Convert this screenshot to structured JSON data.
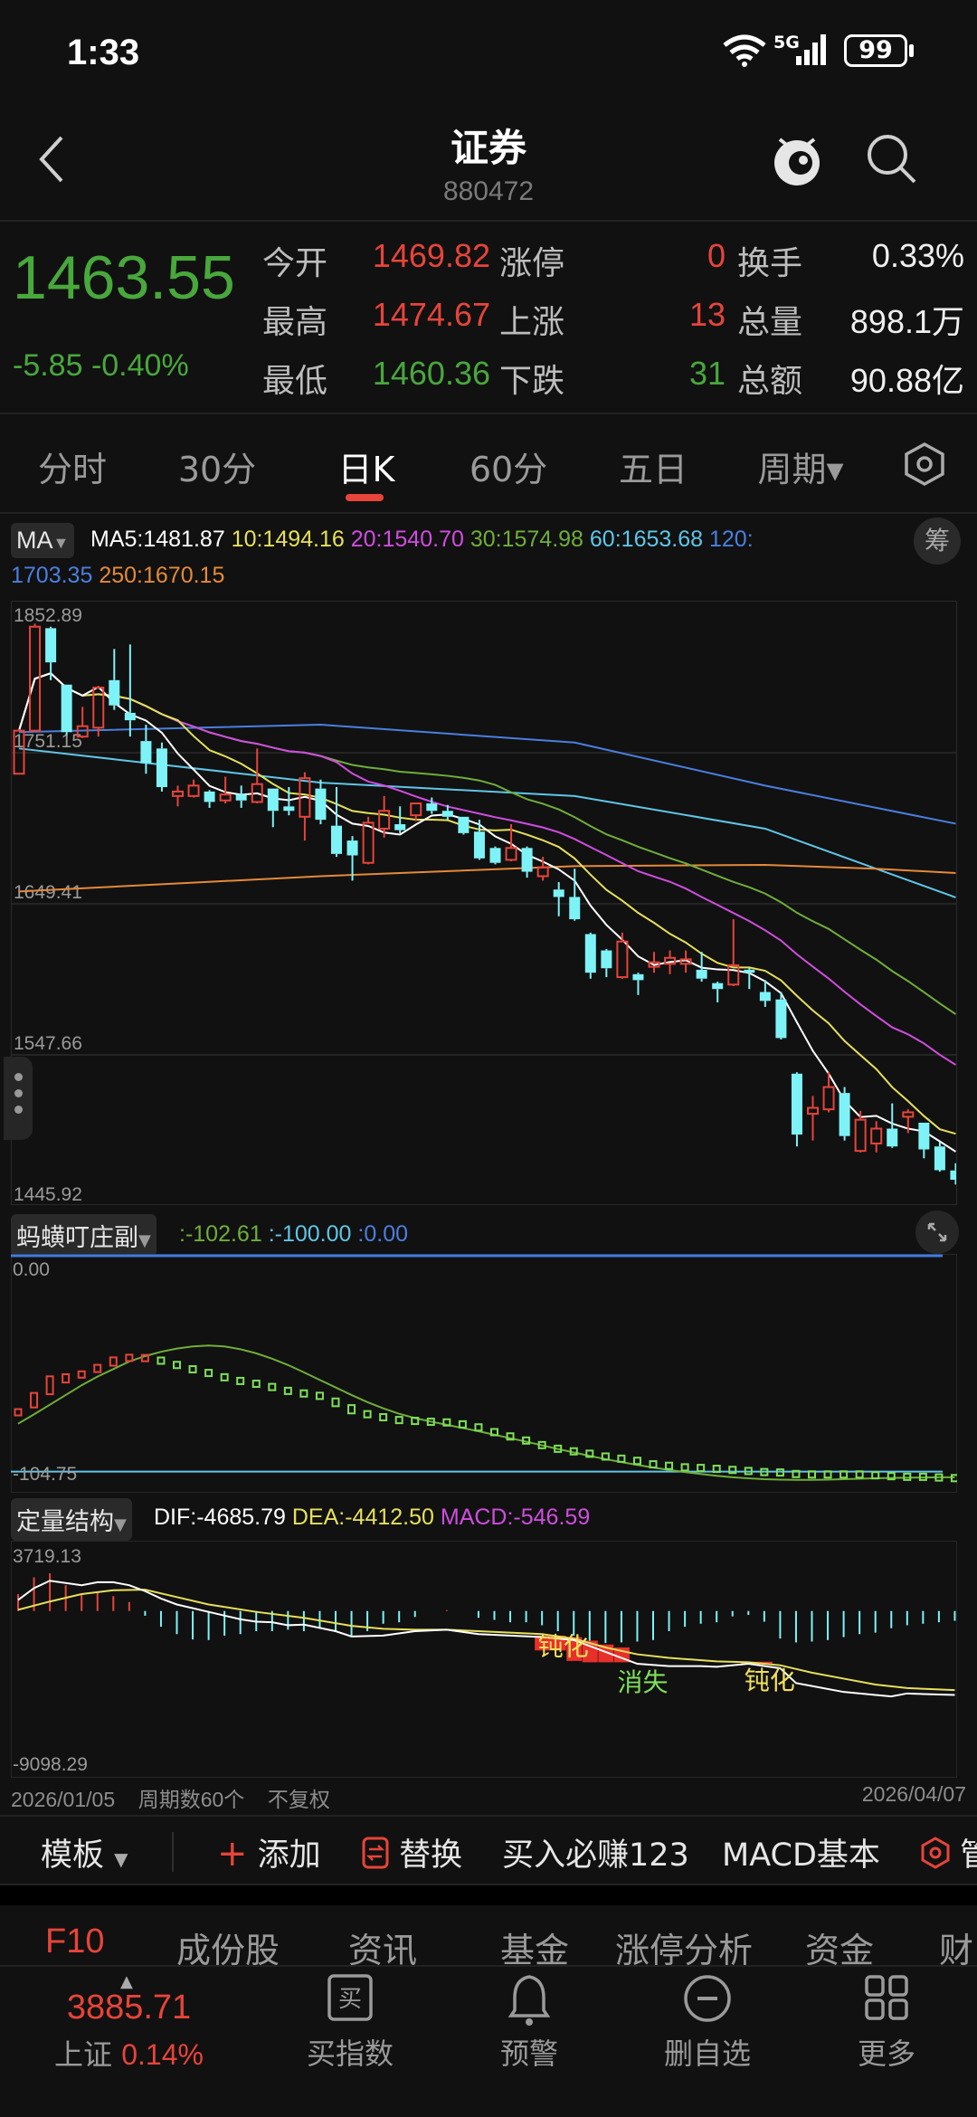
{
  "status_bar": {
    "time": "1:33",
    "network": "5G",
    "battery": "99"
  },
  "header": {
    "title": "证券",
    "code": "880472"
  },
  "quote": {
    "price": "1463.55",
    "change": "-5.85",
    "change_pct": "-0.40%",
    "rows": [
      {
        "label1": "今开",
        "value1": "1469.82",
        "color1": "#e8443a",
        "label2": "涨停",
        "count": "0",
        "count_color": "#e8443a",
        "label3": "换手",
        "value3": "0.33%"
      },
      {
        "label1": "最高",
        "value1": "1474.67",
        "color1": "#e8443a",
        "label2": "上涨",
        "count": "13",
        "count_color": "#e8443a",
        "label3": "总量",
        "value3": "898.1万"
      },
      {
        "label1": "最低",
        "value1": "1460.36",
        "color1": "#48a83c",
        "label2": "下跌",
        "count": "31",
        "count_color": "#48a83c",
        "label3": "总额",
        "value3": "90.88亿"
      }
    ]
  },
  "tabs": [
    {
      "label": "分时"
    },
    {
      "label": "30分"
    },
    {
      "label": "日K",
      "active": true
    },
    {
      "label": "60分"
    },
    {
      "label": "五日"
    },
    {
      "label": "周期▾"
    }
  ],
  "ma_legend": {
    "selector": "MA",
    "ma5": "MA5:1481.87",
    "ma10": "10:1494.16",
    "ma20": "20:1540.70",
    "ma30": "30:1574.98",
    "ma60": "60:1653.68",
    "ma120_label": "120:",
    "ma120_value": "1703.35",
    "ma250": "250:1670.15",
    "chip_button": "筹"
  },
  "sub1_legend": {
    "selector": "蚂蟥叮庄副",
    "v1": ":-102.61",
    "v2": ":-100.00",
    "v3": ":0.00"
  },
  "sub2_legend": {
    "selector": "定量结构",
    "dif": "DIF:-4685.79",
    "dea": "DEA:-4412.50",
    "macd": "MACD:-546.59"
  },
  "footer_info": {
    "start_date": "2026/01/05",
    "periods": "周期数60个",
    "adjust": "不复权",
    "end_date": "2026/04/07"
  },
  "toolbar": {
    "template": "模板",
    "add": "添加",
    "replace": "替换",
    "item1": "买入必赚123",
    "item2": "MACD基本",
    "manage": "管"
  },
  "f10_tabs": [
    "F10",
    "成份股",
    "资讯",
    "基金",
    "涨停分析",
    "资金",
    "财"
  ],
  "bottom_nav": {
    "index_value": "3885.71",
    "index_name": "上证",
    "index_pct": "0.14%",
    "items": [
      {
        "label": "买指数",
        "icon": "buy-icon"
      },
      {
        "label": "预警",
        "icon": "bell-icon"
      },
      {
        "label": "删自选",
        "icon": "minus-circle-icon"
      },
      {
        "label": "更多",
        "icon": "grid-icon"
      }
    ]
  },
  "colors": {
    "up": "#e8443a",
    "down": "#7ef3f7",
    "ma5": "#ffffff",
    "ma10": "#e6e05a",
    "ma20": "#d04de0",
    "ma30": "#6fae3a",
    "ma60": "#5fc6e8",
    "ma120": "#4a7fe0",
    "ma250": "#e58a3a"
  },
  "chart_data": [
    {
      "type": "candlestick",
      "title": "日K",
      "ylim": [
        1445.92,
        1852.89
      ],
      "y_ticks": [
        "1852.89",
        "1751.15",
        "1649.41",
        "1547.66",
        "1445.92"
      ],
      "ohlc": [
        [
          1737,
          1767,
          1737,
          1766
        ],
        [
          1766,
          1838,
          1766,
          1836
        ],
        [
          1835,
          1836,
          1800,
          1812
        ],
        [
          1797,
          1797,
          1763,
          1765
        ],
        [
          1762,
          1782,
          1761,
          1769
        ],
        [
          1768,
          1796,
          1762,
          1795
        ],
        [
          1800,
          1821,
          1780,
          1783
        ],
        [
          1778,
          1824,
          1762,
          1773
        ],
        [
          1759,
          1770,
          1737,
          1744
        ],
        [
          1754,
          1758,
          1725,
          1728
        ],
        [
          1722,
          1729,
          1715,
          1725
        ],
        [
          1722,
          1733,
          1721,
          1729
        ],
        [
          1725,
          1726,
          1714,
          1718
        ],
        [
          1719,
          1735,
          1717,
          1723
        ],
        [
          1723,
          1729,
          1714,
          1719
        ],
        [
          1718,
          1754,
          1717,
          1730
        ],
        [
          1727,
          1727,
          1701,
          1712
        ],
        [
          1715,
          1728,
          1709,
          1712
        ],
        [
          1708,
          1738,
          1692,
          1734
        ],
        [
          1727,
          1733,
          1703,
          1706
        ],
        [
          1702,
          1728,
          1681,
          1683
        ],
        [
          1692,
          1695,
          1665,
          1682
        ],
        [
          1677,
          1708,
          1676,
          1704
        ],
        [
          1700,
          1722,
          1694,
          1712
        ],
        [
          1703,
          1715,
          1697,
          1699
        ],
        [
          1709,
          1717,
          1705,
          1717
        ],
        [
          1717,
          1721,
          1710,
          1712
        ],
        [
          1712,
          1716,
          1706,
          1708
        ],
        [
          1708,
          1708,
          1696,
          1697
        ],
        [
          1698,
          1706,
          1679,
          1680
        ],
        [
          1687,
          1688,
          1676,
          1677
        ],
        [
          1679,
          1703,
          1678,
          1687
        ],
        [
          1687,
          1688,
          1667,
          1671
        ],
        [
          1668,
          1681,
          1665,
          1674
        ],
        [
          1659,
          1664,
          1641,
          1654
        ],
        [
          1654,
          1673,
          1638,
          1639
        ],
        [
          1629,
          1630,
          1599,
          1603
        ],
        [
          1618,
          1619,
          1600,
          1606
        ],
        [
          1600,
          1630,
          1599,
          1624
        ],
        [
          1602,
          1603,
          1588,
          1598
        ],
        [
          1607,
          1617,
          1603,
          1610
        ],
        [
          1609,
          1618,
          1602,
          1613
        ],
        [
          1609,
          1618,
          1603,
          1612
        ],
        [
          1605,
          1617,
          1597,
          1599
        ],
        [
          1596,
          1597,
          1583,
          1592
        ],
        [
          1595,
          1639,
          1594,
          1608
        ],
        [
          1605,
          1606,
          1592,
          1603
        ],
        [
          1590,
          1598,
          1580,
          1584
        ],
        [
          1585,
          1590,
          1558,
          1559
        ],
        [
          1535,
          1536,
          1486,
          1494
        ],
        [
          1508,
          1520,
          1490,
          1512
        ],
        [
          1511,
          1536,
          1509,
          1526
        ],
        [
          1522,
          1526,
          1490,
          1493
        ],
        [
          1483,
          1510,
          1482,
          1504
        ],
        [
          1488,
          1503,
          1482,
          1498
        ],
        [
          1498,
          1515,
          1485,
          1486
        ],
        [
          1506,
          1511,
          1495,
          1509
        ],
        [
          1502,
          1502,
          1478,
          1484
        ],
        [
          1486,
          1489,
          1469,
          1470
        ],
        [
          1469.82,
          1474.67,
          1460.36,
          1463.55
        ]
      ],
      "ma_periods": [
        5,
        10,
        20,
        30
      ],
      "ma_long": {
        "ma60": [
          [
            1,
            1754
          ],
          [
            20,
            1731
          ],
          [
            36,
            1722
          ],
          [
            48,
            1700
          ],
          [
            55,
            1673
          ],
          [
            60,
            1653.68
          ]
        ],
        "ma120": [
          [
            1,
            1765
          ],
          [
            20,
            1770
          ],
          [
            36,
            1758
          ],
          [
            48,
            1729
          ],
          [
            60,
            1703.35
          ]
        ],
        "ma250": [
          [
            1,
            1657.7
          ],
          [
            20,
            1668
          ],
          [
            36,
            1674.8
          ],
          [
            48,
            1675.6
          ],
          [
            55,
            1673
          ],
          [
            60,
            1670.15
          ]
        ]
      }
    },
    {
      "type": "bar+line",
      "title": "蚂蟥叮庄副",
      "ylim": [
        -104.75,
        0
      ],
      "y_ticks": [
        "0.00",
        "-104.75"
      ],
      "ref_lines": [
        0,
        -100
      ],
      "red_count": 9,
      "boxes": [
        -72.5,
        -66.9,
        -60.0,
        -56.8,
        -55.0,
        -52.2,
        -49.0,
        -47.3,
        -47.4,
        -48.6,
        -50.6,
        -52.6,
        -54.3,
        -56.3,
        -58.0,
        -59.3,
        -60.8,
        -62.6,
        -63.8,
        -64.9,
        -67.9,
        -71.1,
        -73.4,
        -74.8,
        -76.1,
        -76.5,
        -76.9,
        -77.2,
        -78.1,
        -79.5,
        -81.7,
        -83.7,
        -85.6,
        -87.7,
        -89.4,
        -90.6,
        -91.7,
        -93.0,
        -94.0,
        -95.0,
        -96.6,
        -97.3,
        -98.0,
        -98.3,
        -98.7,
        -99.2,
        -99.7,
        -100.2,
        -100.4,
        -101.1,
        -101.3,
        -101.3,
        -101.3,
        -101.3,
        -101.7,
        -102.1,
        -102.4,
        -102.4,
        -102.7,
        -103.0
      ],
      "line": [
        -77.8,
        -73.5,
        -69,
        -64.5,
        -60,
        -56,
        -52.5,
        -49,
        -46.5,
        -44.5,
        -43,
        -42,
        -41.6,
        -42,
        -43.3,
        -45.2,
        -47.7,
        -50.6,
        -54,
        -57.5,
        -61,
        -64.5,
        -67.8,
        -70.7,
        -73.2,
        -75.2,
        -76.8,
        -78.3,
        -79.8,
        -81.3,
        -82.9,
        -84.5,
        -86.1,
        -87.8,
        -89.5,
        -91.1,
        -92.7,
        -94.2,
        -95.6,
        -96.9,
        -98.1,
        -99.2,
        -100.2,
        -101.1,
        -101.9,
        -102.6,
        -103.1,
        -103.5,
        -103.7,
        -103.8,
        -103.8,
        -103.7,
        -103.5,
        -103.3,
        -103.1,
        -102.9,
        -102.8,
        -102.7,
        -102.6,
        -102.61
      ]
    },
    {
      "type": "macd",
      "title": "定量结构",
      "ylim": [
        -9098.29,
        3719.13
      ],
      "y_ticks": [
        "3719.13",
        "-9098.29"
      ],
      "histogram": [
        940,
        1880,
        2100,
        1440,
        940,
        1060,
        830,
        500,
        -265,
        -877,
        -1290,
        -1588,
        -1621,
        -1373,
        -1290,
        -1125,
        -1125,
        -1042,
        -1125,
        -959,
        -1125,
        -1373,
        -1125,
        -711,
        -629,
        -331,
        0,
        50,
        0,
        -380,
        -496,
        -629,
        -629,
        -794,
        -1125,
        -1373,
        -1704,
        -1786,
        -1753,
        -1704,
        -1621,
        -1125,
        -877,
        -711,
        -629,
        -298,
        -215,
        -595,
        -1538,
        -1753,
        -1704,
        -1621,
        -1456,
        -1290,
        -1207,
        -959,
        -794,
        -711,
        -629,
        -546.59
      ],
      "dif": [
        [
          1,
          612
        ],
        [
          2,
          1274
        ],
        [
          3,
          1687
        ],
        [
          5,
          1439
        ],
        [
          6,
          1604
        ],
        [
          7,
          1604
        ],
        [
          8,
          1439
        ],
        [
          9,
          1108
        ],
        [
          10,
          695
        ],
        [
          11,
          364
        ],
        [
          13,
          -50
        ],
        [
          15,
          -463
        ],
        [
          16,
          -595
        ],
        [
          17,
          -629
        ],
        [
          18,
          -794
        ],
        [
          19,
          -761
        ],
        [
          21,
          -1125
        ],
        [
          22,
          -1422
        ],
        [
          24,
          -1373
        ],
        [
          26,
          -1125
        ],
        [
          28,
          -1042
        ],
        [
          30,
          -1290
        ],
        [
          32,
          -1373
        ],
        [
          34,
          -1456
        ],
        [
          36,
          -1621
        ],
        [
          38,
          -2283
        ],
        [
          40,
          -2944
        ],
        [
          42,
          -3076
        ],
        [
          44,
          -3076
        ],
        [
          45,
          -3110
        ],
        [
          47,
          -2944
        ],
        [
          49,
          -3192
        ],
        [
          50,
          -4019
        ],
        [
          51,
          -4185
        ],
        [
          53,
          -4515
        ],
        [
          55,
          -4681
        ],
        [
          56,
          -4764
        ],
        [
          57,
          -4598
        ],
        [
          58,
          -4631
        ],
        [
          60,
          -4685.79
        ]
      ],
      "dea": [
        [
          1,
          66
        ],
        [
          3,
          529
        ],
        [
          5,
          943
        ],
        [
          7,
          1158
        ],
        [
          9,
          1191
        ],
        [
          11,
          777
        ],
        [
          13,
          364
        ],
        [
          16,
          -50
        ],
        [
          19,
          -380
        ],
        [
          22,
          -827
        ],
        [
          24,
          -992
        ],
        [
          26,
          -1042
        ],
        [
          28,
          -1042
        ],
        [
          30,
          -1125
        ],
        [
          34,
          -1290
        ],
        [
          36,
          -1538
        ],
        [
          38,
          -2034
        ],
        [
          40,
          -2415
        ],
        [
          42,
          -2613
        ],
        [
          45,
          -2812
        ],
        [
          47,
          -2861
        ],
        [
          49,
          -3027
        ],
        [
          51,
          -3440
        ],
        [
          53,
          -3771
        ],
        [
          55,
          -4102
        ],
        [
          57,
          -4300
        ],
        [
          60,
          -4412.5
        ]
      ],
      "blocks": [
        [
          34,
          35,
          -1373,
          -2200
        ],
        [
          36,
          36,
          -1456,
          -2785
        ],
        [
          37,
          37,
          -1654,
          -2861
        ],
        [
          38,
          38,
          -1869,
          -2861
        ],
        [
          39,
          39,
          -2034,
          -2861
        ],
        [
          47,
          48,
          -2829,
          -2977
        ]
      ],
      "annotations": [
        {
          "text": "钝化",
          "index": 35,
          "value": -2450,
          "color": "#f0e060"
        },
        {
          "text": "消失",
          "index": 40,
          "value": -4450,
          "color": "#7ee05a"
        },
        {
          "text": "钝化",
          "index": 48,
          "value": -4350,
          "color": "#f0e060"
        }
      ]
    }
  ]
}
